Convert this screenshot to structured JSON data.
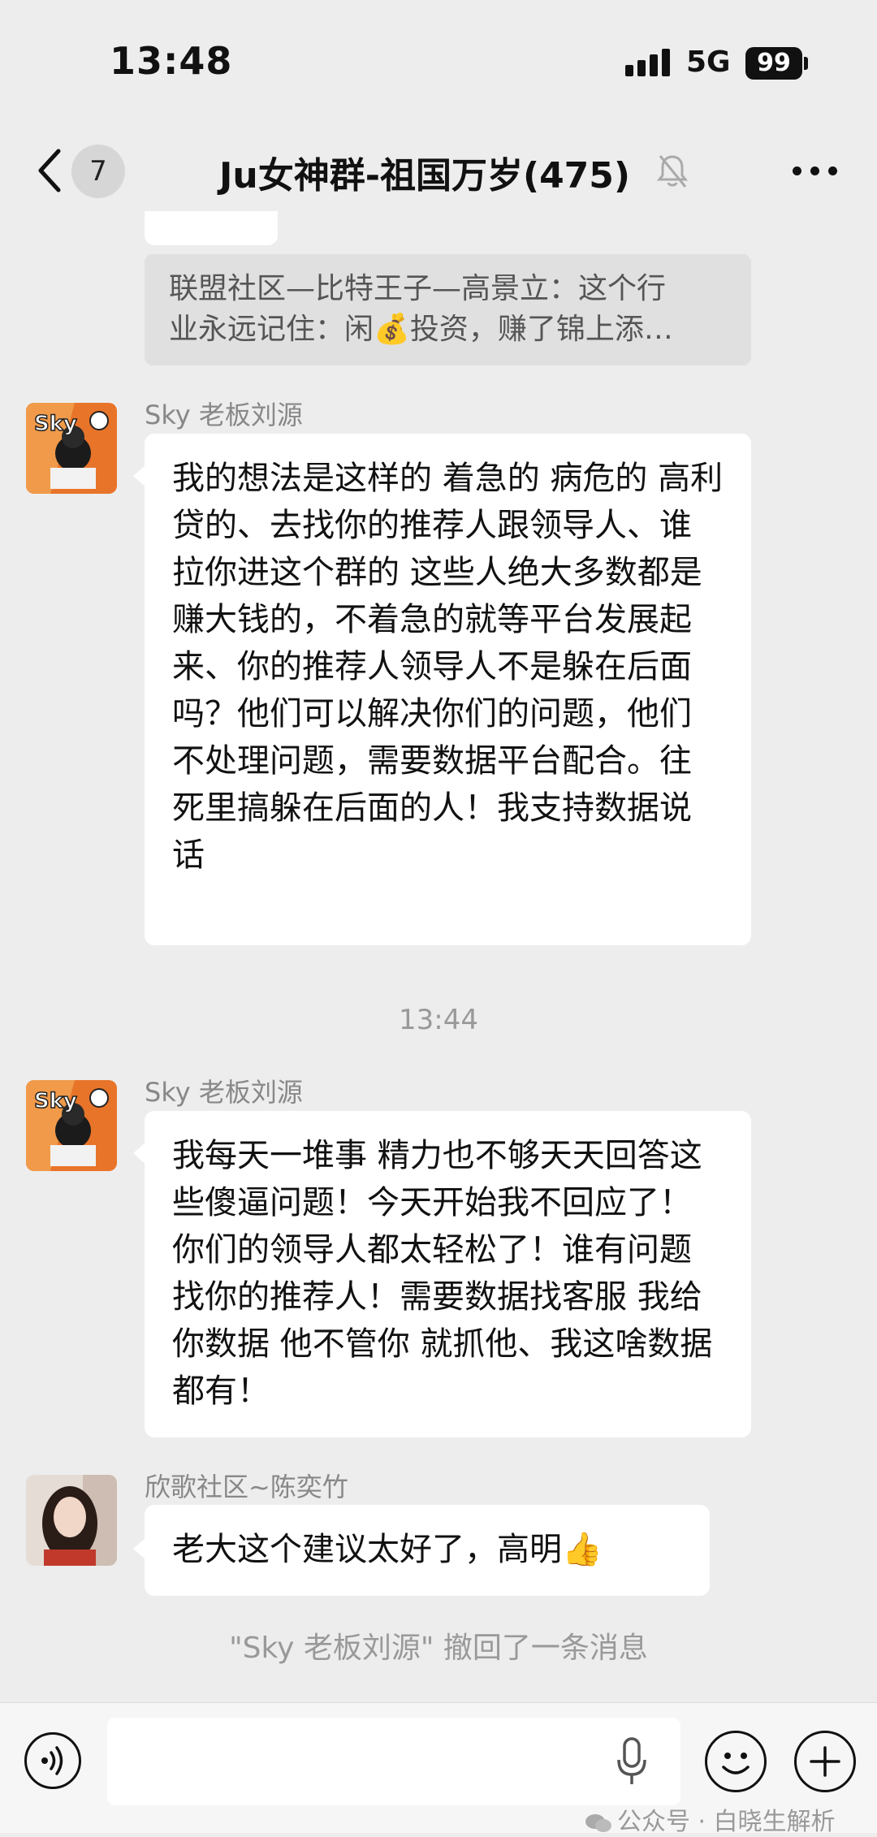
{
  "status_bar": {
    "time": "13:48",
    "network": "5G",
    "battery": "99"
  },
  "nav": {
    "unread_count": "7",
    "title": "Ju女神群-祖国万岁(475)",
    "icons": [
      "back-arrow-icon",
      "mute-bell-icon",
      "more-dots-icon"
    ]
  },
  "quote": {
    "line1": "联盟社区—比特王子—高景立：这个行",
    "line2_pre": "业永远记住：闲",
    "line2_emoji": "💰",
    "line2_post": "投资，赚了锦上添…"
  },
  "messages": [
    {
      "sender": "Sky 老板刘源",
      "text": "我的想法是这样的 着急的 病危的 高利贷的、去找你的推荐人跟领导人、谁拉你进这个群的 这些人绝大多数都是赚大钱的，不着急的就等平台发展起来、你的推荐人领导人不是躲在后面吗？他们可以解决你们的问题，他们不处理问题，需要数据平台配合。往死里搞躲在后面的人！我支持数据说话",
      "avatar_label": "Sky"
    },
    {
      "sender": "Sky 老板刘源",
      "text": "我每天一堆事 精力也不够天天回答这些傻逼问题！今天开始我不回应了！你们的领导人都太轻松了！谁有问题找你的推荐人！需要数据找客服 我给你数据 他不管你 就抓他、我这啥数据都有！",
      "avatar_label": "Sky"
    },
    {
      "sender": "欣歌社区~陈奕竹",
      "text": "老大这个建议太好了，高明",
      "emoji": "👍"
    }
  ],
  "timestamp": "13:44",
  "system_notice": "\"Sky 老板刘源\" 撤回了一条消息",
  "watermark": "公众号 · 白晓生解析",
  "colors": {
    "background": "#ededed",
    "bubble": "#ffffff",
    "system_text": "#999999"
  }
}
